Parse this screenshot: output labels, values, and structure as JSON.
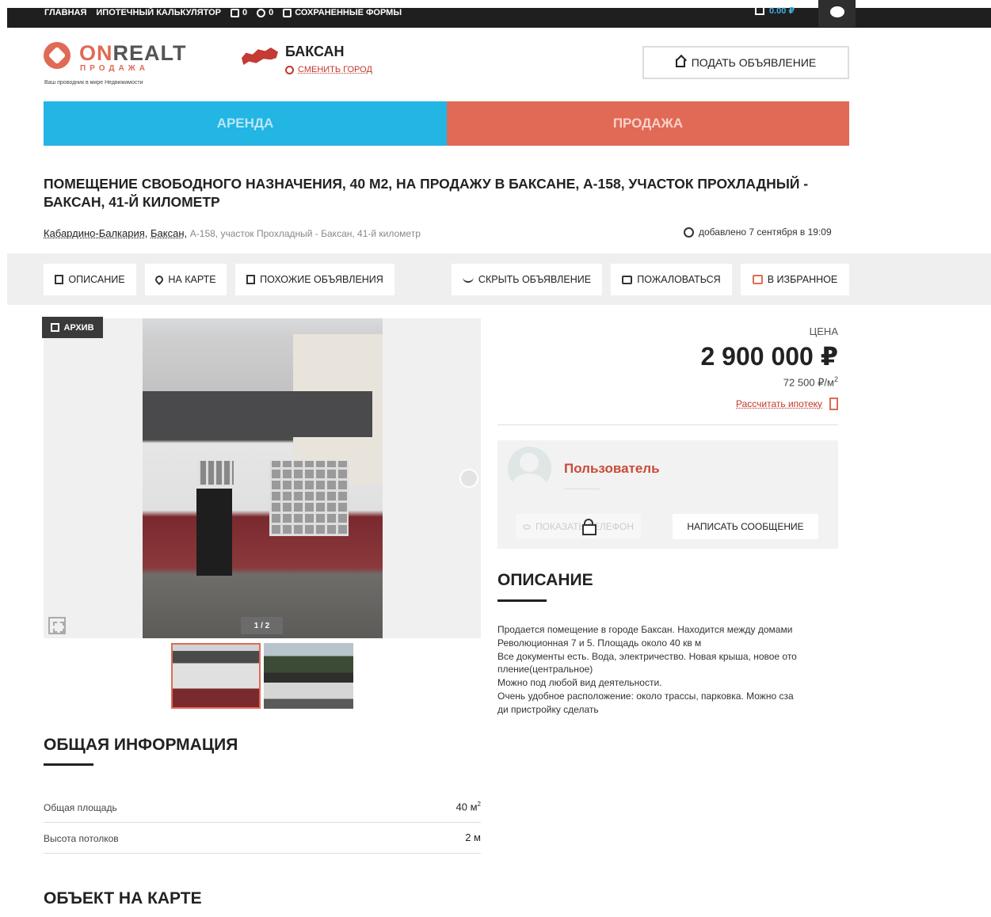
{
  "topbar": {
    "nav": [
      "ГЛАВНАЯ",
      "ИПОТЕЧНЫЙ КАЛЬКУЛЯТОР"
    ],
    "compare_count": "0",
    "chat_count": "0",
    "saved_forms": "СОХРАНЕННЫЕ ФОРМЫ",
    "balance": "0.00 ₽"
  },
  "logo": {
    "on": "ON",
    "rest": "REALT",
    "sub": "ПРОДАЖА",
    "tagline": "Ваш проводник в мире Недвижимости"
  },
  "city": {
    "name": "БАКСАН",
    "change": "СМЕНИТЬ ГОРОД"
  },
  "post_button": "ПОДАТЬ ОБЪЯВЛЕНИЕ",
  "tabs": {
    "rent": "АРЕНДА",
    "sale": "ПРОДАЖА"
  },
  "listing": {
    "title": "ПОМЕЩЕНИЕ СВОБОДНОГО НАЗНАЧЕНИЯ, 40 М2, НА ПРОДАЖУ В БАКСАНЕ, А-158, УЧАСТОК ПРОХЛАДНЫЙ - БАКСАН, 41-Й КИЛОМЕТР",
    "region": "Кабардино-Балкария",
    "city": "Баксан",
    "street": "А-158, участок Прохладный - Баксан, 41-й километр",
    "added": "добавлено 7 сентября в 19:09"
  },
  "actions": {
    "description": "ОПИСАНИЕ",
    "on_map": "НА КАРТЕ",
    "similar": "ПОХОЖИЕ ОБЪЯВЛЕНИЯ",
    "hide": "СКРЫТЬ ОБЪЯВЛЕНИЕ",
    "report": "ПОЖАЛОВАТЬСЯ",
    "favorite": "В ИЗБРАННОЕ"
  },
  "gallery": {
    "badge": "АРХИВ",
    "counter": "1 / 2"
  },
  "price": {
    "label": "ЦЕНА",
    "value": "2 900 000 ₽",
    "per_sqm": "72 500 ₽/м",
    "mortgage_link": "Рассчитать ипотеку"
  },
  "seller": {
    "name": "Пользователь",
    "show_phone": "ПОКАЗАТЬ ТЕЛЕФОН",
    "write_message": "НАПИСАТЬ СООБЩЕНИЕ"
  },
  "description": {
    "heading": "ОПИСАНИЕ",
    "text": "Продается помещение в городе Баксан. Находится между домами\nРеволюционная 7 и 5. Площадь около 40 кв м\nВсе документы есть. Вода, электричество. Новая крыша, новое ото\nпление(центральное)\nМожно под любой вид деятельности.\nОчень удобное расположение: около трассы, парковка. Можно сза\nди пристройку сделать"
  },
  "general_info": {
    "heading": "ОБЩАЯ ИНФОРМАЦИЯ",
    "rows": [
      {
        "key": "Общая площадь",
        "value": "40 м",
        "sup": "2"
      },
      {
        "key": "Высота потолков",
        "value": "2 м",
        "sup": ""
      }
    ]
  },
  "map_section": {
    "heading": "ОБЪЕКТ НА КАРТЕ"
  },
  "colors": {
    "accent": "#e06a55",
    "rent": "#23b5e3",
    "dark": "#1f1f1f"
  }
}
